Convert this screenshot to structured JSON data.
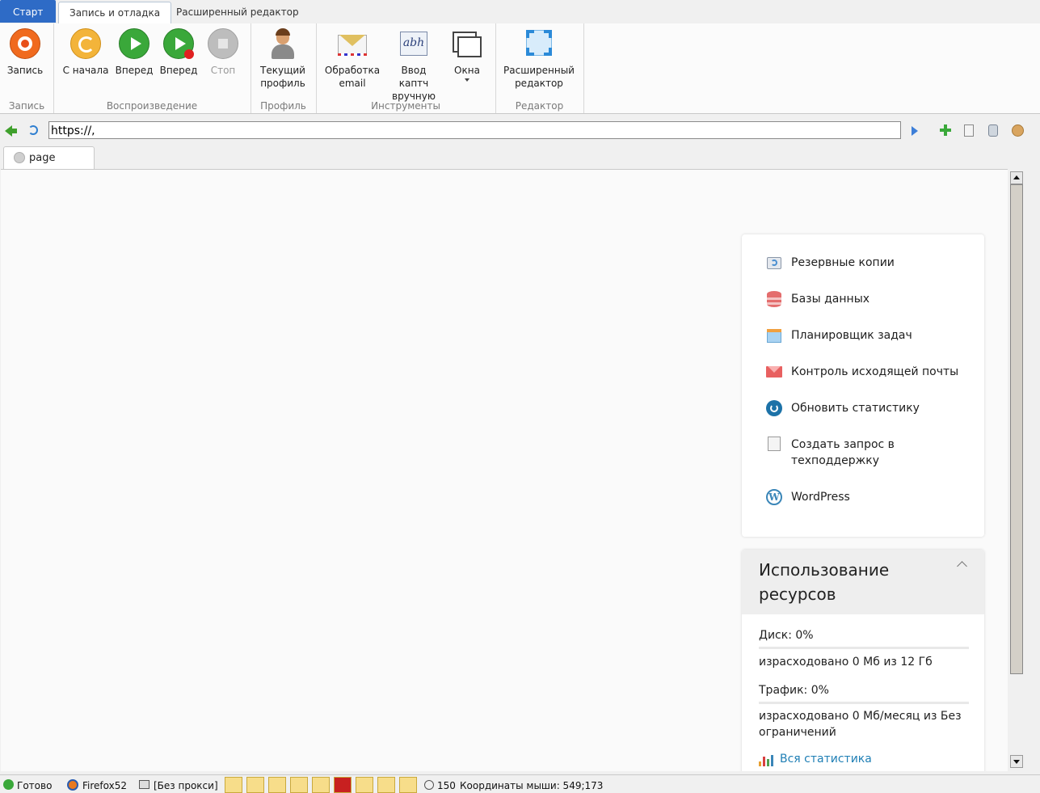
{
  "ribbon_tabs": {
    "start": "Старт",
    "record_debug": "Запись и отладка",
    "advanced_editor": "Расширенный редактор"
  },
  "ribbon": {
    "groups": {
      "record": "Запись",
      "playback": "Воспроизведение",
      "profile": "Профиль",
      "tools": "Инструменты",
      "editor": "Редактор"
    },
    "buttons": {
      "record": "Запись",
      "from_start": "С начала",
      "forward": "Вперед",
      "forward_bp": "Вперед",
      "stop": "Стоп",
      "current_profile_1": "Текущий",
      "current_profile_2": "профиль",
      "email_1": "Обработка",
      "email_2": "email",
      "captcha_1": "Ввод каптч",
      "captcha_2": "вручную",
      "windows": "Окна",
      "adv_editor_1": "Расширенный",
      "adv_editor_2": "редактор"
    }
  },
  "address_bar": {
    "url": "https://,"
  },
  "page_tab": {
    "label": "page"
  },
  "menu": [
    {
      "label": "Резервные копии",
      "icon": "backup-icon"
    },
    {
      "label": "Базы данных",
      "icon": "database-icon"
    },
    {
      "label": "Планировщик задач",
      "icon": "calendar-icon"
    },
    {
      "label": "Контроль исходящей почты",
      "icon": "mail-icon"
    },
    {
      "label": "Обновить статистику",
      "icon": "refresh-icon"
    },
    {
      "label": "Создать запрос в техподдержку",
      "icon": "support-icon"
    },
    {
      "label": "WordPress",
      "icon": "wordpress-icon"
    }
  ],
  "resources": {
    "title": "Использование ресурсов",
    "disk": "Диск: 0%",
    "disk_used": "израсходовано 0 Мб из 12 Гб",
    "traffic": "Трафик: 0%",
    "traffic_used": "израсходовано 0 Мб/месяц из Без ограничений",
    "all_stats": "Вся статистика"
  },
  "status": {
    "ready": "Готово",
    "browser": "Firefox52",
    "proxy": "[Без прокси]",
    "count": "150",
    "mouse": "Координаты мыши: 549;173"
  }
}
